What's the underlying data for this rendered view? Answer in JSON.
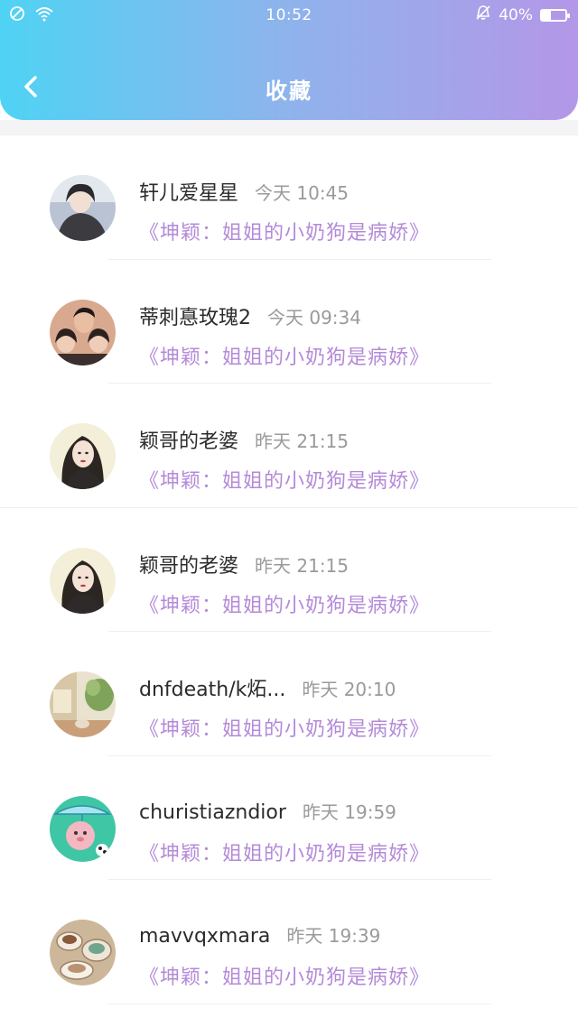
{
  "status_bar": {
    "time": "10:52",
    "battery": "40%",
    "battery_level": 0.4,
    "icons": [
      "no-sim-icon",
      "wifi-icon",
      "bell-muted-icon",
      "battery-icon"
    ]
  },
  "header": {
    "title": "收藏",
    "back_icon": "chevron-left-icon",
    "gradient": [
      "#4fd3f4",
      "#b497e8"
    ]
  },
  "colors": {
    "book_title": "#b48ad8",
    "username": "#2b2b2b",
    "time": "#9a9a9a"
  },
  "items": [
    {
      "user": "轩儿爱星星",
      "time": "今天 10:45",
      "book": "《坤颖：姐姐的小奶狗是病娇》"
    },
    {
      "user": "蒂刺惪玫瑰2",
      "time": "今天 09:34",
      "book": "《坤颖：姐姐的小奶狗是病娇》"
    },
    {
      "user": "颖哥的老婆",
      "time": "昨天 21:15",
      "book": "《坤颖：姐姐的小奶狗是病娇》"
    },
    {
      "user": "颖哥的老婆",
      "time": "昨天 21:15",
      "book": "《坤颖：姐姐的小奶狗是病娇》"
    },
    {
      "user": "dnfdeath/k炻...",
      "time": "昨天 20:10",
      "book": "《坤颖：姐姐的小奶狗是病娇》"
    },
    {
      "user": "churistiazndior",
      "time": "昨天 19:59",
      "book": "《坤颖：姐姐的小奶狗是病娇》"
    },
    {
      "user": "mavvqxmara",
      "time": "昨天 19:39",
      "book": "《坤颖：姐姐的小奶狗是病娇》"
    }
  ]
}
